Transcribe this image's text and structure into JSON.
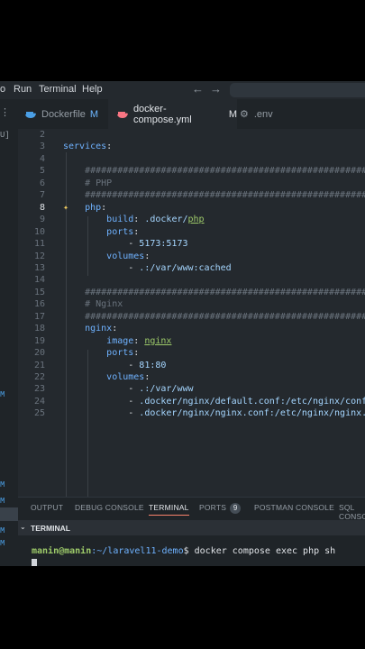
{
  "menu": {
    "items": [
      "o",
      "Run",
      "Terminal",
      "Help"
    ],
    "back": "←",
    "forward": "→"
  },
  "tabs": [
    {
      "label": "Dockerfile",
      "status": "M",
      "active": false
    },
    {
      "label": "docker-compose.yml",
      "status": "M",
      "active": true
    },
    {
      "label": ".env",
      "status": "",
      "active": false
    }
  ],
  "explorer": {
    "top_text": "U]",
    "badges": [
      "M",
      "M",
      "M",
      "M",
      "M"
    ]
  },
  "editor": {
    "current_line": 8,
    "lines": [
      {
        "n": "2",
        "t": ""
      },
      {
        "n": "3",
        "t": "services:"
      },
      {
        "n": "4",
        "t": ""
      },
      {
        "n": "5",
        "t": "    ##########################################################"
      },
      {
        "n": "6",
        "t": "    # PHP"
      },
      {
        "n": "7",
        "t": "    ##########################################################"
      },
      {
        "n": "8",
        "t": "    php:"
      },
      {
        "n": "9",
        "t": "        build: .docker/php"
      },
      {
        "n": "10",
        "t": "        ports:"
      },
      {
        "n": "11",
        "t": "            - 5173:5173"
      },
      {
        "n": "12",
        "t": "        volumes:"
      },
      {
        "n": "13",
        "t": "            - .:/var/www:cached"
      },
      {
        "n": "14",
        "t": ""
      },
      {
        "n": "15",
        "t": "    ##########################################################"
      },
      {
        "n": "16",
        "t": "    # Nginx"
      },
      {
        "n": "17",
        "t": "    ##########################################################"
      },
      {
        "n": "18",
        "t": "    nginx:"
      },
      {
        "n": "19",
        "t": "        image: nginx"
      },
      {
        "n": "20",
        "t": "        ports:"
      },
      {
        "n": "21",
        "t": "            - 81:80"
      },
      {
        "n": "22",
        "t": "        volumes:"
      },
      {
        "n": "23",
        "t": "            - .:/var/www"
      },
      {
        "n": "24",
        "t": "            - .docker/nginx/default.conf:/etc/nginx/conf.d/default.conf"
      },
      {
        "n": "25",
        "t": "            - .docker/nginx/nginx.conf:/etc/nginx/nginx.conf"
      }
    ]
  },
  "panel": {
    "tabs": [
      "OUTPUT",
      "DEBUG CONSOLE",
      "TERMINAL",
      "PORTS",
      "POSTMAN CONSOLE",
      "SQL CONSOLE"
    ],
    "active_tab": "TERMINAL",
    "ports_count": "9",
    "terminal_title": "TERMINAL",
    "prompt_user": "manin@manin",
    "prompt_path": ":~/laravel11-demo",
    "prompt_symbol": "$",
    "command": " docker compose exec php sh"
  },
  "colors": {
    "key": "#6fb2ff",
    "string": "#a5d6ff",
    "value": "#9ecb6a",
    "comment": "#6a737d",
    "prompt": "#9ecb6a",
    "accent": "#f9826c"
  }
}
